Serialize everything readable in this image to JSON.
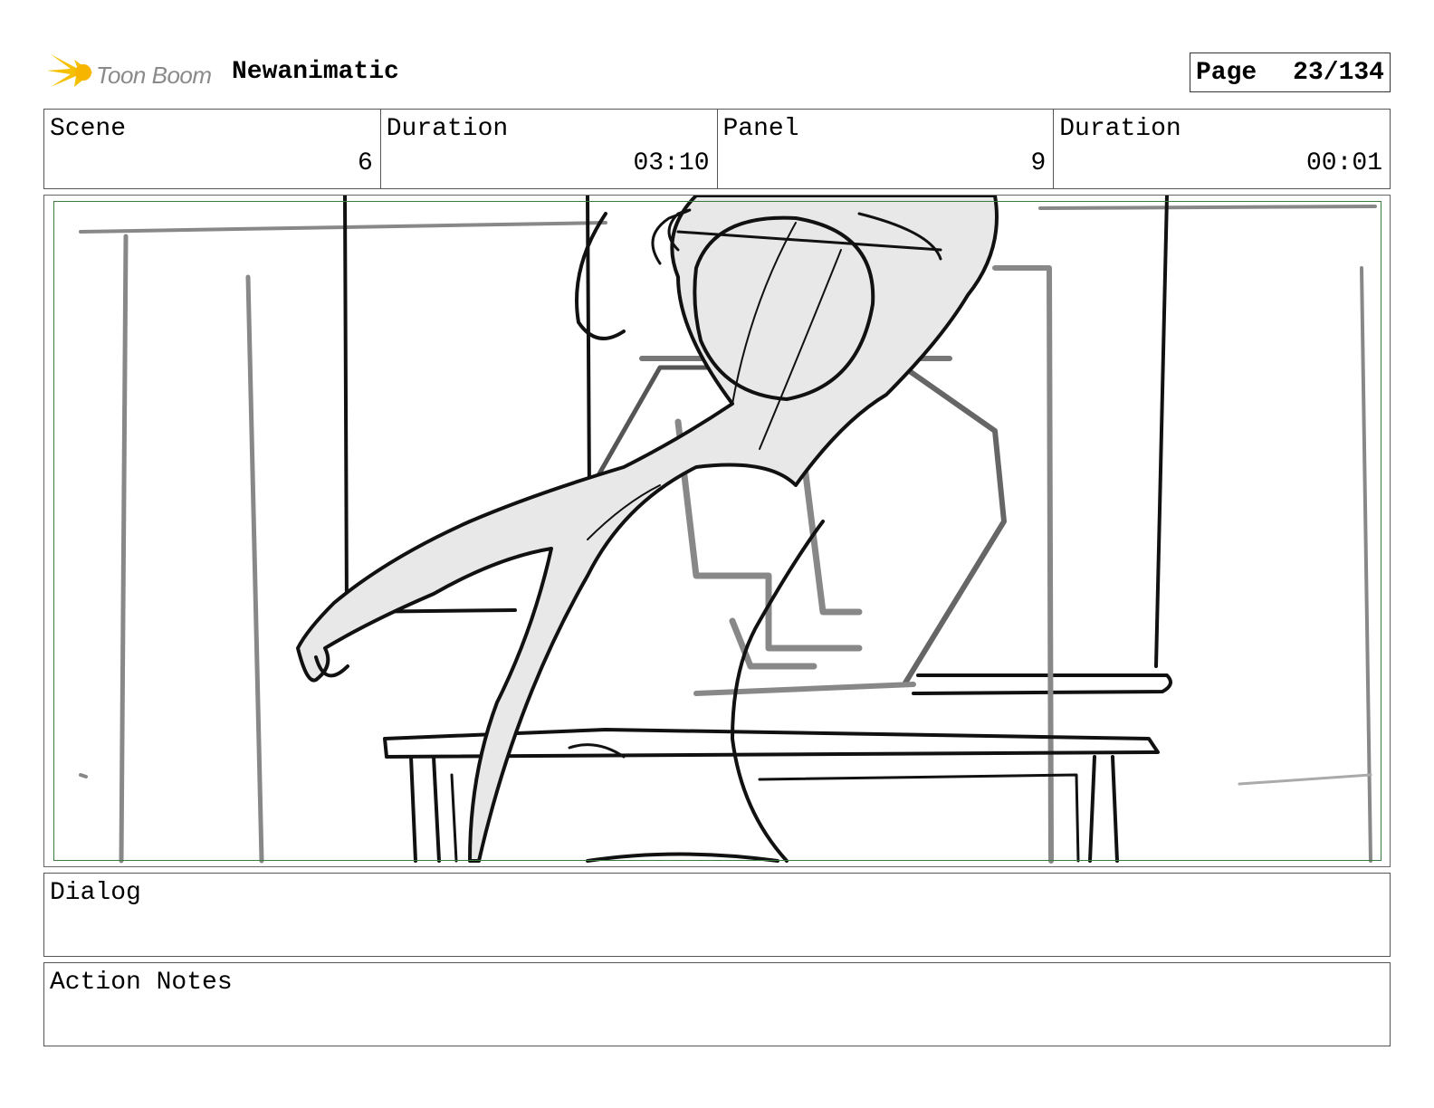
{
  "header": {
    "logo_text": "Toon Boom",
    "project_title": "Newanimatic",
    "page_label": "Page",
    "page_number": "23/134"
  },
  "info": {
    "scene_label": "Scene",
    "scene_value": "6",
    "scene_duration_label": "Duration",
    "scene_duration_value": "03:10",
    "panel_label": "Panel",
    "panel_value": "9",
    "panel_duration_label": "Duration",
    "panel_duration_value": "00:01"
  },
  "dialog": {
    "label": "Dialog"
  },
  "action_notes": {
    "label": "Action Notes"
  },
  "colors": {
    "safe_frame": "#3d7a3d",
    "logo_accent": "#f5c000",
    "sketch_fill": "#e8e8e8"
  },
  "icons": [
    "toon-boom-logo-icon"
  ]
}
